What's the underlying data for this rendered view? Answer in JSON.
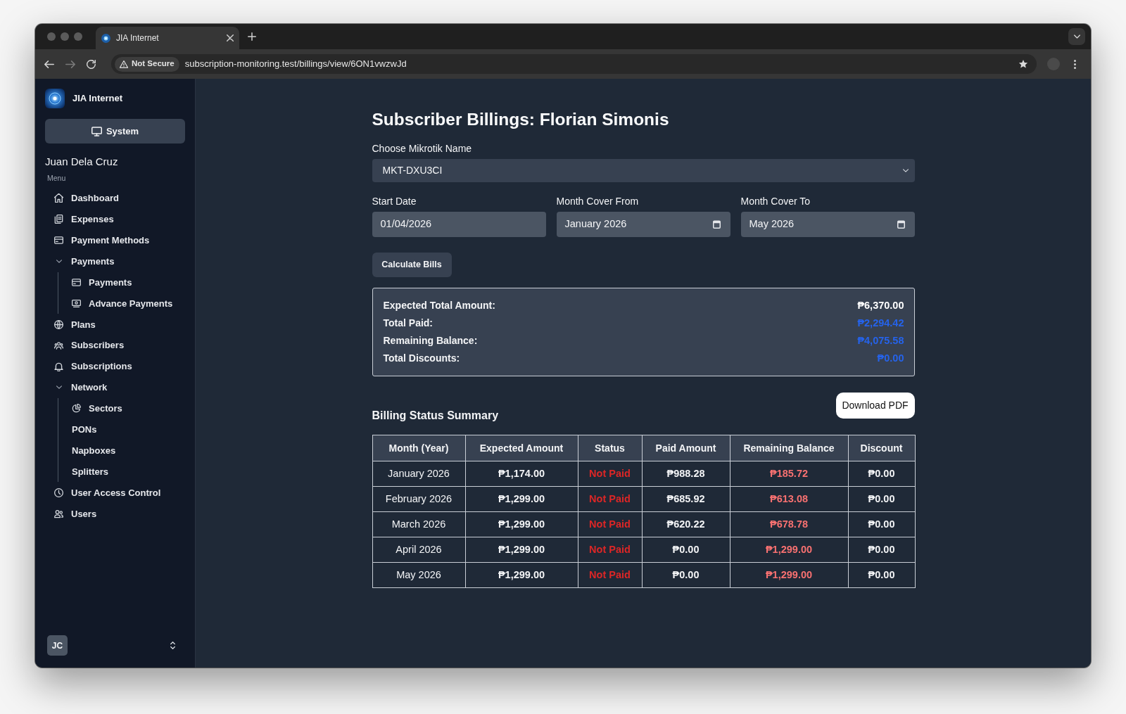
{
  "browser": {
    "tabs": [
      {
        "title": "JIA Internet",
        "selected": true
      }
    ],
    "security_chip": "Not Secure",
    "url": "subscription-monitoring.test/billings/view/6ON1vwzwJd"
  },
  "sidebar": {
    "brand": "JIA Internet",
    "system_button": "System",
    "user_name": "Juan Dela Cruz",
    "menu_label": "Menu",
    "items": [
      {
        "label": "Dashboard"
      },
      {
        "label": "Expenses"
      },
      {
        "label": "Payment Methods"
      },
      {
        "label": "Payments",
        "expanded": true,
        "children": [
          {
            "label": "Payments"
          },
          {
            "label": "Advance Payments"
          }
        ]
      },
      {
        "label": "Plans"
      },
      {
        "label": "Subscribers"
      },
      {
        "label": "Subscriptions"
      },
      {
        "label": "Network",
        "expanded": true,
        "children": [
          {
            "label": "Sectors"
          },
          {
            "label": "PONs"
          },
          {
            "label": "Napboxes"
          },
          {
            "label": "Splitters"
          }
        ]
      },
      {
        "label": "User Access Control"
      },
      {
        "label": "Users"
      }
    ],
    "user_initials": "JC"
  },
  "page": {
    "title": "Subscriber Billings: Florian Simonis",
    "mikrotik_select": {
      "label": "Choose Mikrotik Name",
      "value": "MKT-DXU3CI"
    },
    "date_fields": [
      {
        "kind": "date",
        "label": "Start Date",
        "value": "01/04/2026"
      },
      {
        "kind": "month",
        "label": "Month Cover From",
        "value": "January 2026"
      },
      {
        "kind": "month",
        "label": "Month Cover To",
        "value": "May 2026"
      }
    ],
    "calculate_button": "Calculate Bills",
    "totals": [
      {
        "label": "Expected Total Amount:",
        "value": "₱6,370.00",
        "color": "#ffffff"
      },
      {
        "label": "Total Paid:",
        "value": "₱2,294.42",
        "color": "#2563eb"
      },
      {
        "label": "Remaining Balance:",
        "value": "₱4,075.58",
        "color": "#2563eb"
      },
      {
        "label": "Total Discounts:",
        "value": "₱0.00",
        "color": "#2563eb"
      }
    ],
    "download_button": "Download PDF",
    "billing_table": {
      "title": "Billing Status Summary",
      "columns": [
        "Month (Year)",
        "Expected Amount",
        "Status",
        "Paid Amount",
        "Remaining Balance",
        "Discount"
      ],
      "rows": [
        {
          "month": "January 2026",
          "expected_amount": "₱1,174.00",
          "status": "Not Paid",
          "paid": false,
          "paid_amount": "₱988.28",
          "remaining_balance": "₱185.72",
          "discount": "₱0.00"
        },
        {
          "month": "February 2026",
          "expected_amount": "₱1,299.00",
          "status": "Not Paid",
          "paid": false,
          "paid_amount": "₱685.92",
          "remaining_balance": "₱613.08",
          "discount": "₱0.00"
        },
        {
          "month": "March 2026",
          "expected_amount": "₱1,299.00",
          "status": "Not Paid",
          "paid": false,
          "paid_amount": "₱620.22",
          "remaining_balance": "₱678.78",
          "discount": "₱0.00"
        },
        {
          "month": "April 2026",
          "expected_amount": "₱1,299.00",
          "status": "Not Paid",
          "paid": false,
          "paid_amount": "₱0.00",
          "remaining_balance": "₱1,299.00",
          "discount": "₱0.00"
        },
        {
          "month": "May 2026",
          "expected_amount": "₱1,299.00",
          "status": "Not Paid",
          "paid": false,
          "paid_amount": "₱0.00",
          "remaining_balance": "₱1,299.00",
          "discount": "₱0.00"
        }
      ]
    }
  }
}
